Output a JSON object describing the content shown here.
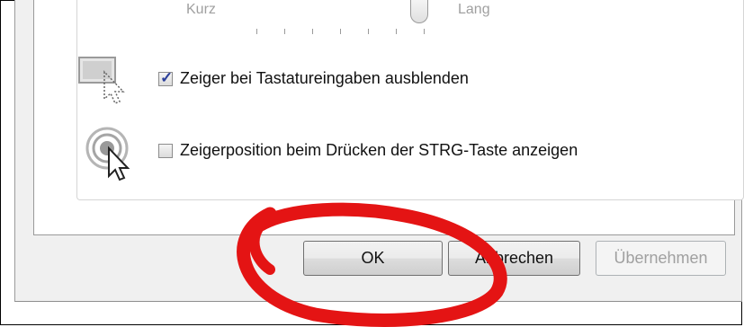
{
  "slider": {
    "min_label": "Kurz",
    "max_label": "Lang"
  },
  "options": [
    {
      "label": "Zeiger bei Tastatureingaben ausblenden",
      "checked": true,
      "icon": "hide-pointer-icon"
    },
    {
      "label": "Zeigerposition beim Drücken der STRG-Taste anzeigen",
      "checked": false,
      "icon": "pointer-location-icon"
    }
  ],
  "buttons": {
    "ok": "OK",
    "cancel": "Abbrechen",
    "apply": "Übernehmen"
  },
  "colors": {
    "annotation": "#e41414",
    "checkmark": "#2b3f9a"
  }
}
